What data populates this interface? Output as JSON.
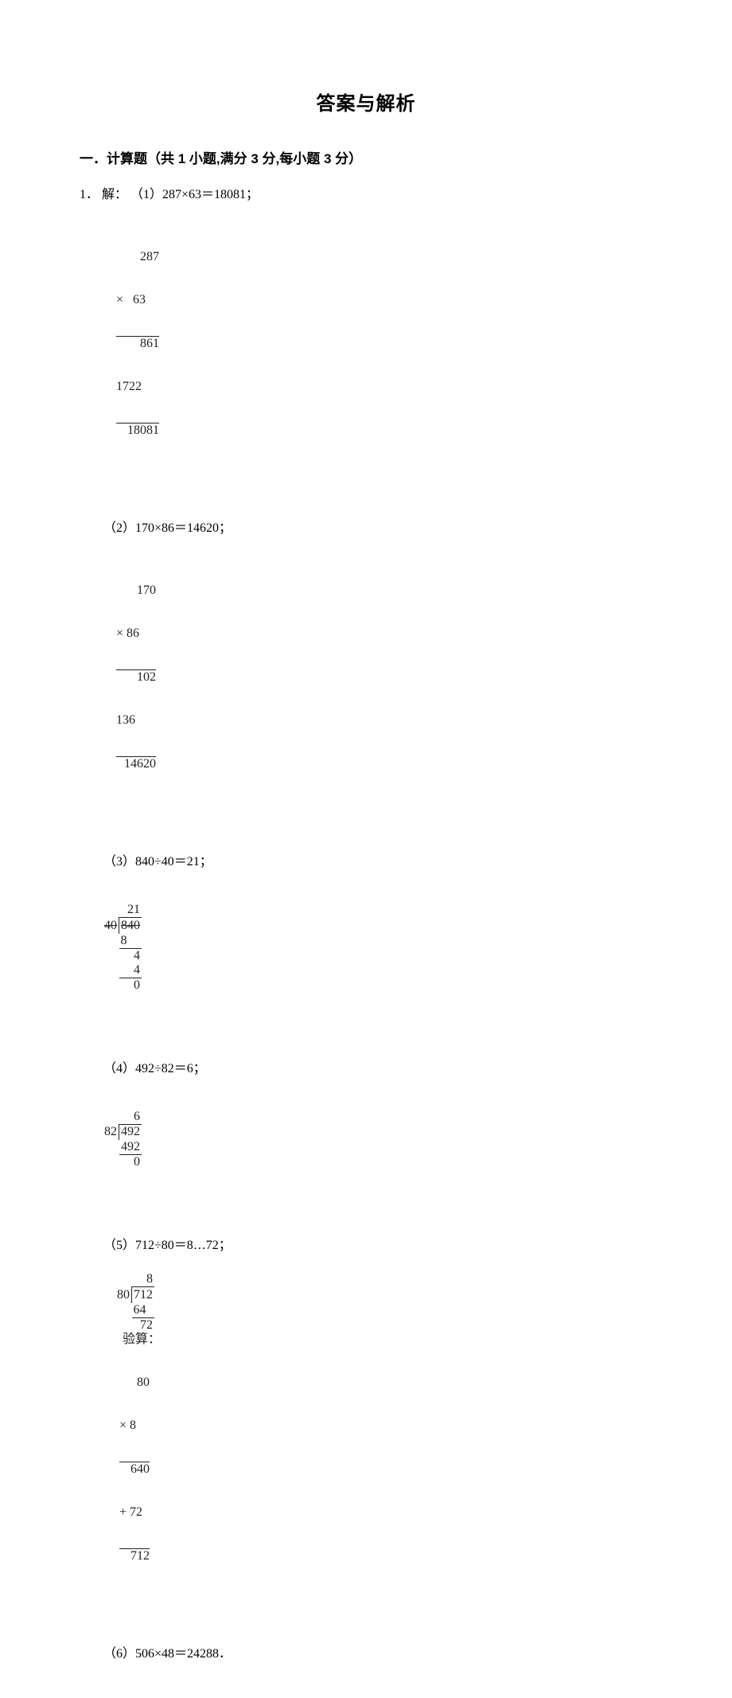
{
  "title": "答案与解析",
  "section": {
    "header": "一．计算题（共 1 小题,满分 3 分,每小题 3 分）"
  },
  "question": {
    "number": "1．",
    "prefix": "解：",
    "parts": {
      "p1": {
        "label": "（1）287×63＝18081；",
        "r1": "287",
        "r2": "×&nbsp;&nbsp;&nbsp;63",
        "r3": "861",
        "r4": "1722&nbsp;&nbsp;",
        "r5": "18081"
      },
      "p2": {
        "label": "（2）170×86＝14620；",
        "r1": "170",
        "r2": "× 86",
        "r3": "102",
        "r4": "136&nbsp;&nbsp;",
        "r5": "14620"
      },
      "p3": {
        "label": "（3）840÷40＝21；",
        "q": "21",
        "divisor": "4∅",
        "dividend": "8̸4̸0̸",
        "s1": "8&nbsp;&nbsp;",
        "s2": "4",
        "s3": "4",
        "s4": "0"
      },
      "p4": {
        "label": "（4）492÷82＝6；",
        "q": "6",
        "divisor": "82",
        "dividend": "492",
        "s1": "492",
        "s2": "0"
      },
      "p5": {
        "label": "（5）712÷80＝8…72；",
        "q": "8",
        "divisor": "80",
        "dividend": "712",
        "s1": "64&nbsp;&nbsp;",
        "s2": "72",
        "check_label": "验算：",
        "c1": "80",
        "c2": "× 8",
        "c3": "640",
        "c4": "+ 72",
        "c5": "712"
      },
      "p6": {
        "label": "（6）506×48＝24288．"
      }
    }
  }
}
